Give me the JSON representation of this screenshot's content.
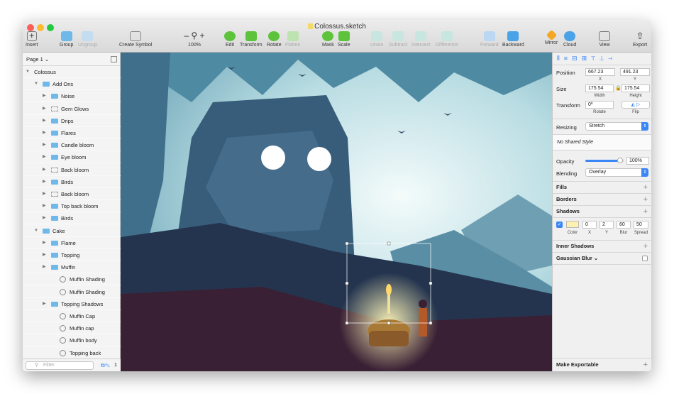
{
  "window": {
    "title": "Colossus.sketch"
  },
  "toolbar": {
    "insert": "Insert",
    "group": "Group",
    "ungroup": "Ungroup",
    "create_symbol": "Create Symbol",
    "zoom": "100%",
    "edit": "Edit",
    "transform": "Transform",
    "rotate": "Rotate",
    "flatten": "Flatten",
    "mask": "Mask",
    "scale": "Scale",
    "union": "Union",
    "subtract": "Subtract",
    "intersect": "Intersect",
    "difference": "Difference",
    "forward": "Forward",
    "backward": "Backward",
    "mirror": "Mirror",
    "cloud": "Cloud",
    "view": "View",
    "export": "Export"
  },
  "layers": {
    "page": "Page 1 ⌄",
    "items": [
      {
        "label": "Colossus"
      },
      {
        "label": "Add Ons"
      },
      {
        "label": "Noise"
      },
      {
        "label": "Gem Glows"
      },
      {
        "label": "Drips"
      },
      {
        "label": "Flares"
      },
      {
        "label": "Candle bloom"
      },
      {
        "label": "Eye bloom"
      },
      {
        "label": "Back bloom"
      },
      {
        "label": "Birds"
      },
      {
        "label": "Back bloom"
      },
      {
        "label": "Top back bloom"
      },
      {
        "label": "Birds"
      },
      {
        "label": "Cake"
      },
      {
        "label": "Flame"
      },
      {
        "label": "Topping"
      },
      {
        "label": "Muffin"
      },
      {
        "label": "Muffin Shading"
      },
      {
        "label": "Muffin Shading"
      },
      {
        "label": "Topping Shadows"
      },
      {
        "label": "Muffin Cap"
      },
      {
        "label": "Muffin cap"
      },
      {
        "label": "Muffin body"
      },
      {
        "label": "Topping back"
      }
    ],
    "filter_placeholder": "Filter",
    "filter_count": "1"
  },
  "inspector": {
    "position_label": "Position",
    "x": "667.23",
    "y": "491.23",
    "x_cap": "X",
    "y_cap": "Y",
    "size_label": "Size",
    "width": "175.54",
    "height": "175.54",
    "width_cap": "Width",
    "height_cap": "Height",
    "transform_label": "Transform",
    "rotate": "0º",
    "rotate_cap": "Rotate",
    "flip_cap": "Flip",
    "resizing_label": "Resizing",
    "resizing_value": "Stretch",
    "shared_style": "No Shared Style",
    "opacity_label": "Opacity",
    "opacity_value": "100%",
    "opacity_level": 0.9,
    "blending_label": "Blending",
    "blending_value": "Overlay",
    "fills": "Fills",
    "borders": "Borders",
    "shadows": "Shadows",
    "shadow": {
      "x": "0",
      "y": "2",
      "blur": "60",
      "spread": "50",
      "color_cap": "Color",
      "x_cap": "X",
      "y_cap": "Y",
      "blur_cap": "Blur",
      "spread_cap": "Spread",
      "color": "#fdf1b0"
    },
    "inner_shadows": "Inner Shadows",
    "gaussian_blur": "Gaussian Blur ⌄",
    "make_exportable": "Make Exportable"
  },
  "colors": {
    "accent": "#3b86f5",
    "folder": "#6fb8ea"
  }
}
